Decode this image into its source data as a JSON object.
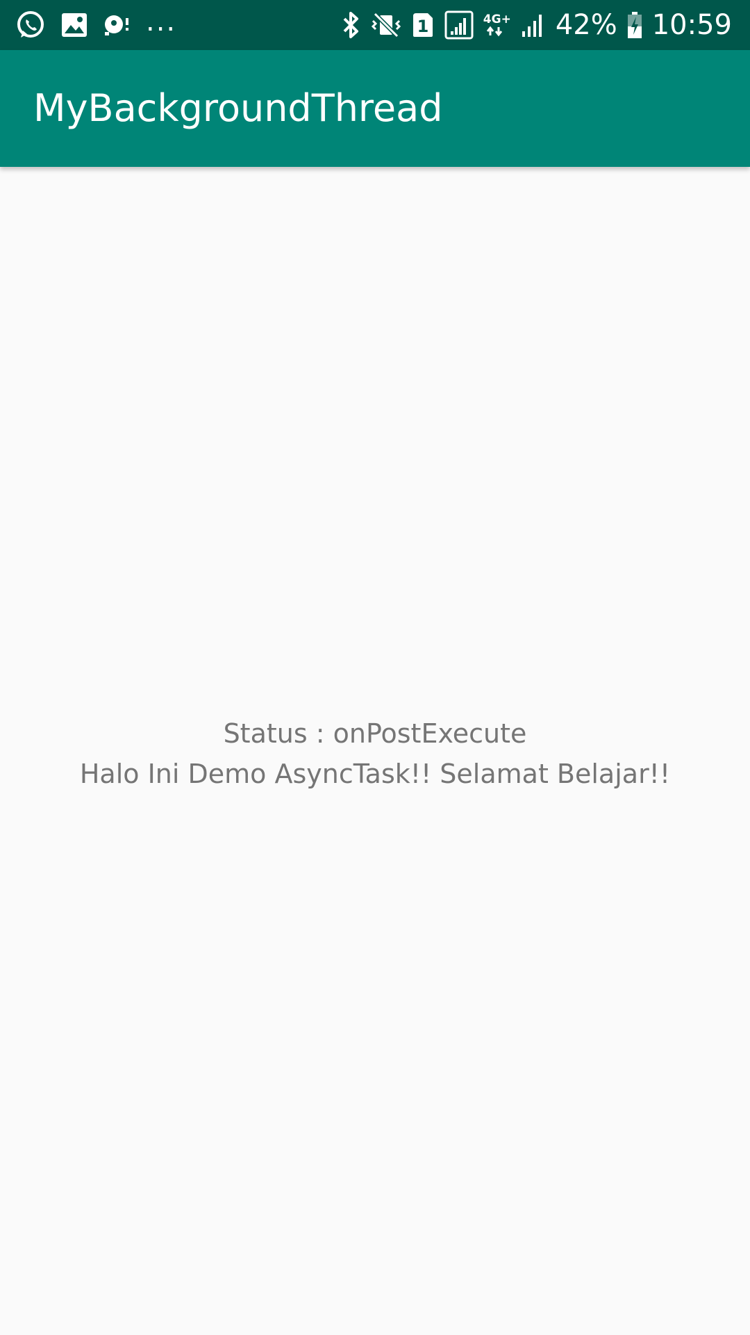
{
  "status_bar": {
    "left_icons": [
      "whatsapp-icon",
      "image-icon",
      "notification-icon"
    ],
    "overflow": "...",
    "right_icons": [
      "bluetooth-icon",
      "vibrate-icon",
      "sim-1-icon",
      "signal-icon",
      "data-4g-icon",
      "signal-icon"
    ],
    "sim_label": "1",
    "network_label": "4G+",
    "battery_percent": "42%",
    "time": "10:59",
    "background": "#00574b"
  },
  "app_bar": {
    "title": "MyBackgroundThread",
    "background": "#008577"
  },
  "main": {
    "status_line": "Status : onPostExecute",
    "message_line": "Halo Ini Demo AsyncTask!! Selamat Belajar!!",
    "text_color": "#757575",
    "background": "#fafafa"
  }
}
